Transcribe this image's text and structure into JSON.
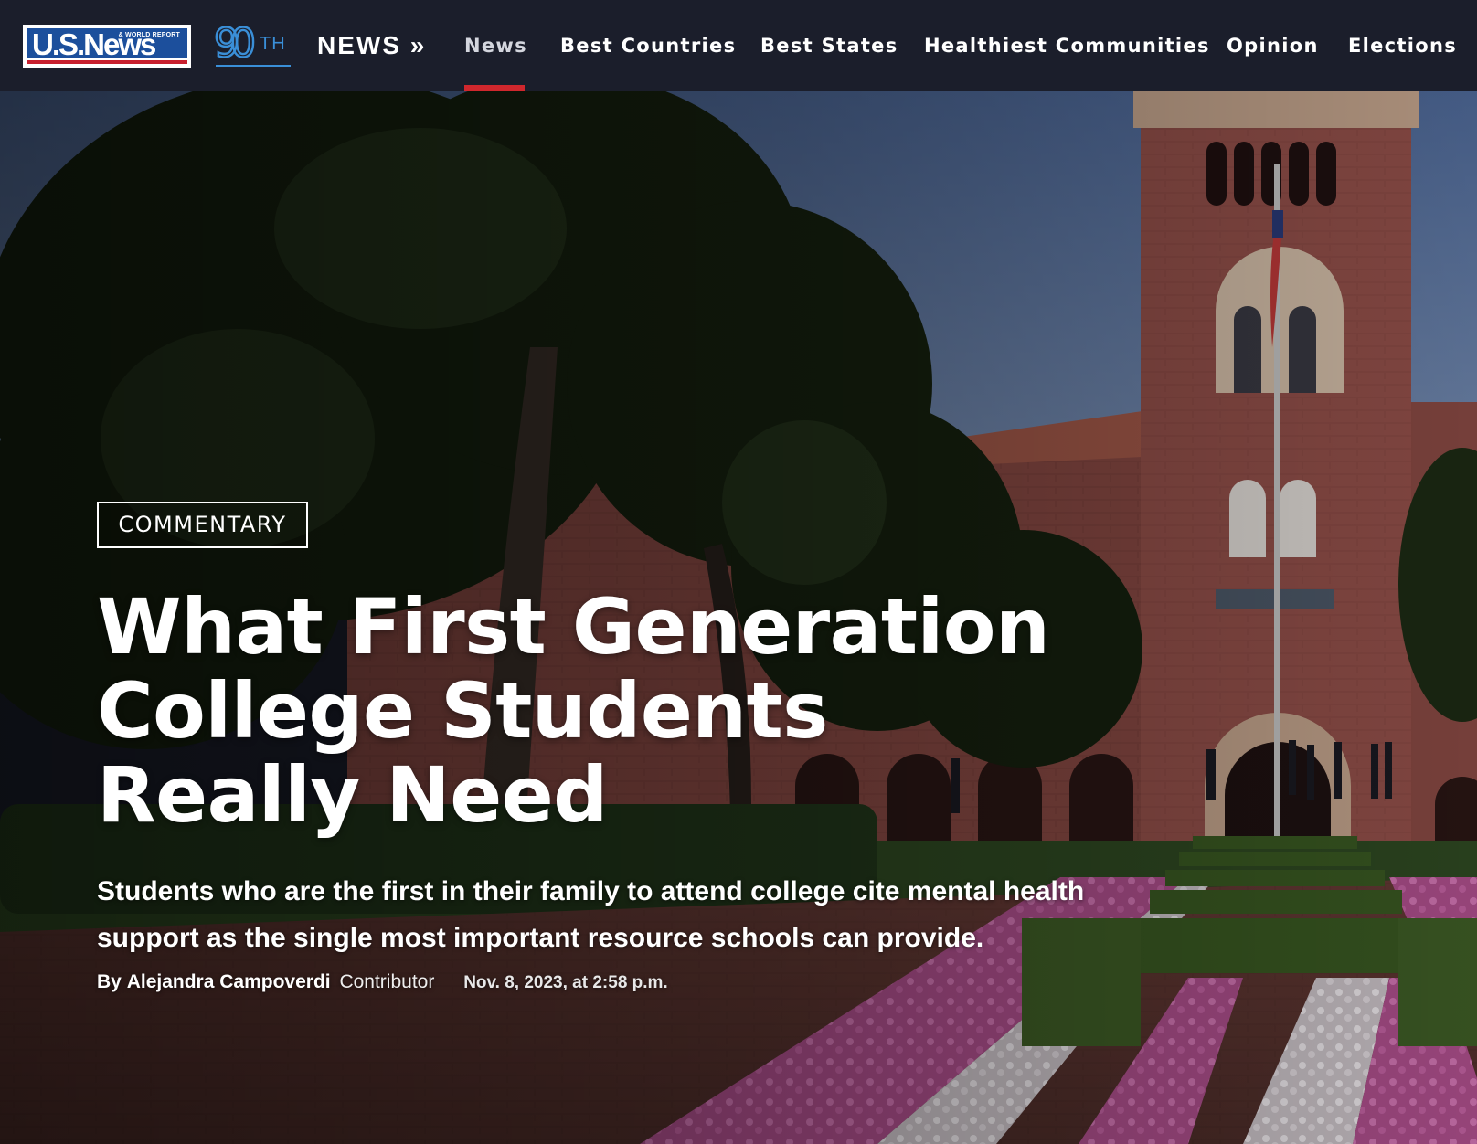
{
  "header": {
    "logo_text": "U.S.News",
    "logo_subtext": "& WORLD REPORT",
    "anniversary_number": "90",
    "anniversary_suffix": "TH",
    "section_label": "NEWS »",
    "nav": [
      {
        "label": "News",
        "active": true
      },
      {
        "label": "Best Countries",
        "active": false
      },
      {
        "label": "Best States",
        "active": false
      },
      {
        "label": "Healthiest Communities",
        "active": false
      },
      {
        "label": "Opinion",
        "active": false
      },
      {
        "label": "Elections",
        "active": false
      }
    ],
    "active_color": "#d0272d"
  },
  "article": {
    "tag": "COMMENTARY",
    "headline_lines": [
      "What First Generation",
      "College Students",
      "Really Need"
    ],
    "dek_lines": [
      "Students who are the first in their family to attend college cite mental health",
      "support as the single most important resource schools can provide."
    ],
    "byline_prefix": "By",
    "author": "Alejandra Campoverdi",
    "author_role": "Contributor",
    "date": "Nov. 8, 2023, at 2:58 p.m."
  },
  "colors": {
    "nav_bg": "#1b1e2b",
    "brand_blue": "#1c4f9c",
    "brand_red": "#c8202f"
  }
}
